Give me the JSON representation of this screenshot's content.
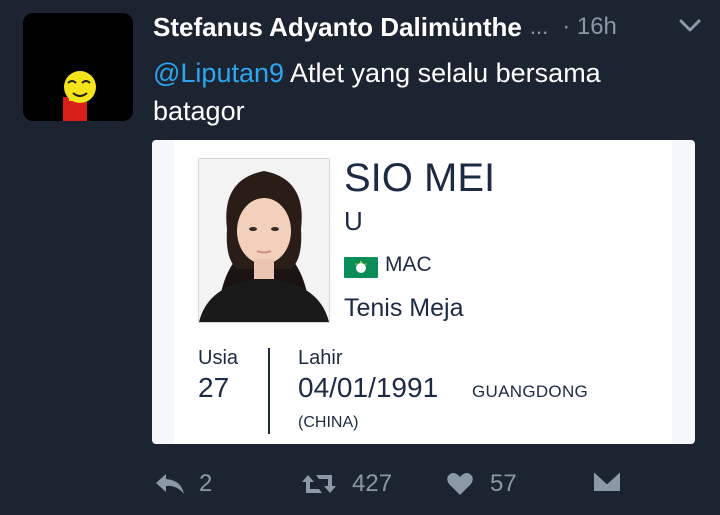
{
  "tweet": {
    "author_name": "Stefanus Adyanto Dalimünthe",
    "ellipsis": "...",
    "time": "· 16h",
    "mention": "@Liputan9",
    "text": " Atlet yang selalu bersama batagor"
  },
  "card": {
    "athlete_name": "SIO MEI",
    "gender": "U",
    "country_code": "MAC",
    "sport": "Tenis Meja",
    "age_label": "Usia",
    "age_value": "27",
    "born_label": "Lahir",
    "born_date": "04/01/1991",
    "birthplace": "GUANGDONG",
    "birth_country": "(CHINA)"
  },
  "actions": {
    "reply_count": "2",
    "retweet_count": "427",
    "like_count": "57"
  },
  "colors": {
    "background": "#1c2431",
    "mention": "#2ba6ef",
    "muted": "#8b98a5",
    "card_text": "#1d2a44",
    "flag_green": "#0b8d5a"
  }
}
